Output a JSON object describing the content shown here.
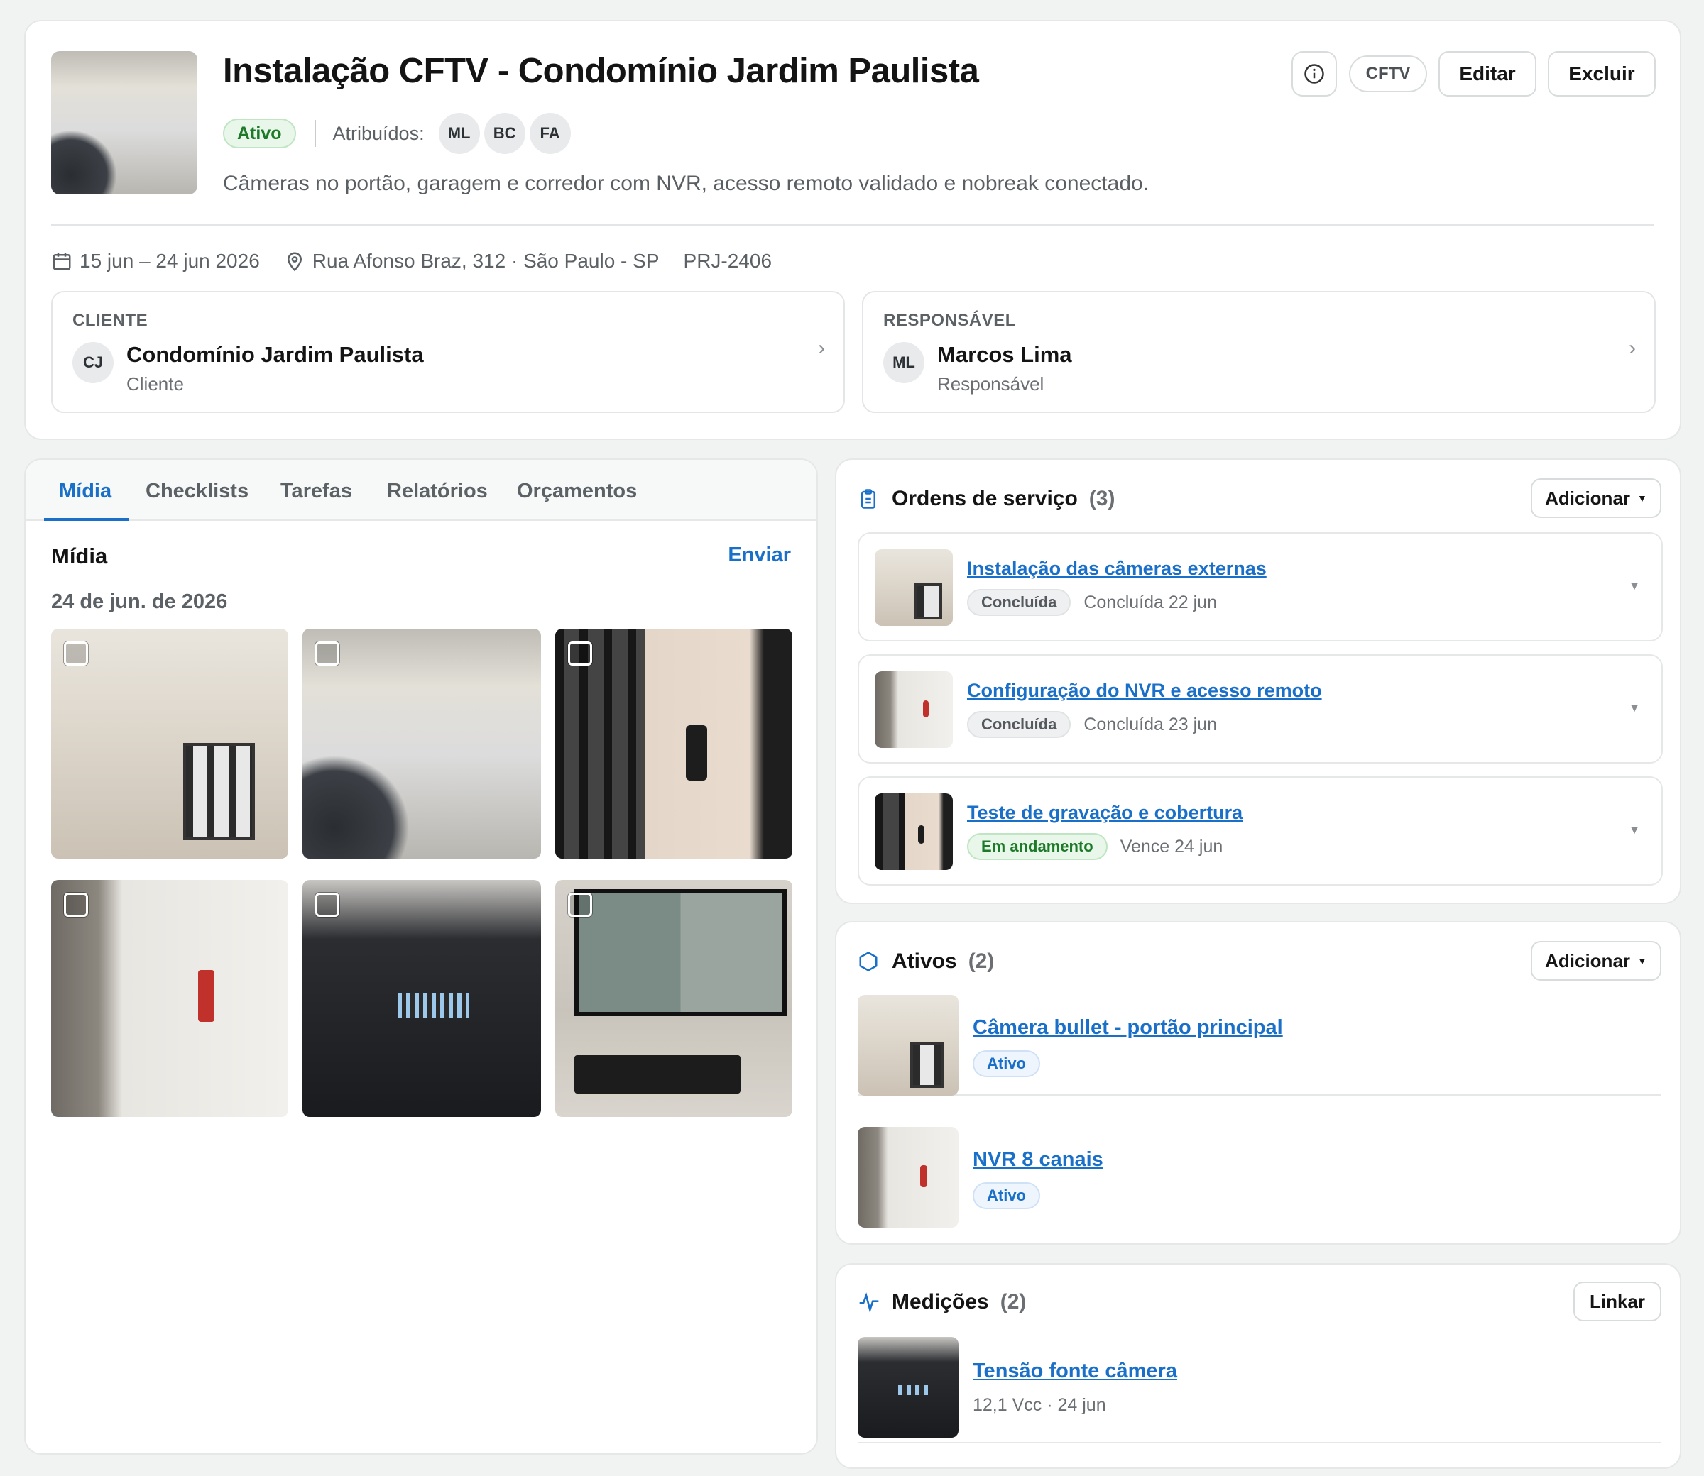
{
  "project": {
    "title": "Instalação CFTV - Condomínio Jardim Paulista",
    "status": "Ativo",
    "assigned_label": "Atribuídos:",
    "assignees": [
      "ML",
      "BC",
      "FA"
    ],
    "description": "Câmeras no portão, garagem e corredor com NVR, acesso remoto validado e nobreak conectado.",
    "dates": "15 jun – 24 jun 2026",
    "address": "Rua Afonso Braz, 312 · São Paulo - SP",
    "code": "PRJ-2406",
    "tag": "CFTV",
    "edit_label": "Editar",
    "delete_label": "Excluir"
  },
  "client": {
    "section": "CLIENTE",
    "initials": "CJ",
    "name": "Condomínio Jardim Paulista",
    "role": "Cliente"
  },
  "responsible": {
    "section": "RESPONSÁVEL",
    "initials": "ML",
    "name": "Marcos Lima",
    "role": "Responsável"
  },
  "tabs": [
    "Mídia",
    "Checklists",
    "Tarefas",
    "Relatórios",
    "Orçamentos"
  ],
  "media": {
    "title": "Mídia",
    "send_label": "Enviar",
    "date_group": "24 de jun. de 2026"
  },
  "service_orders": {
    "title": "Ordens de serviço",
    "count": "(3)",
    "add_label": "Adicionar",
    "items": [
      {
        "title": "Instalação das câmeras externas",
        "status": "Concluída",
        "meta": "Concluída 22 jun"
      },
      {
        "title": "Configuração do NVR e acesso remoto",
        "status": "Concluída",
        "meta": "Concluída 23 jun"
      },
      {
        "title": "Teste de gravação e cobertura",
        "status": "Em andamento",
        "meta": "Vence 24 jun"
      }
    ]
  },
  "assets": {
    "title": "Ativos",
    "count": "(2)",
    "add_label": "Adicionar",
    "items": [
      {
        "title": "Câmera bullet - portão principal",
        "status": "Ativo"
      },
      {
        "title": "NVR 8 canais",
        "status": "Ativo"
      }
    ]
  },
  "measurements": {
    "title": "Medições",
    "count": "(2)",
    "link_label": "Linkar",
    "items": [
      {
        "title": "Tensão fonte câmera",
        "meta": "12,1 Vcc · 24 jun"
      }
    ]
  },
  "colors": {
    "accent": "#1a6fc9",
    "success": "#1c7a28",
    "background": "#f1f3f2"
  }
}
